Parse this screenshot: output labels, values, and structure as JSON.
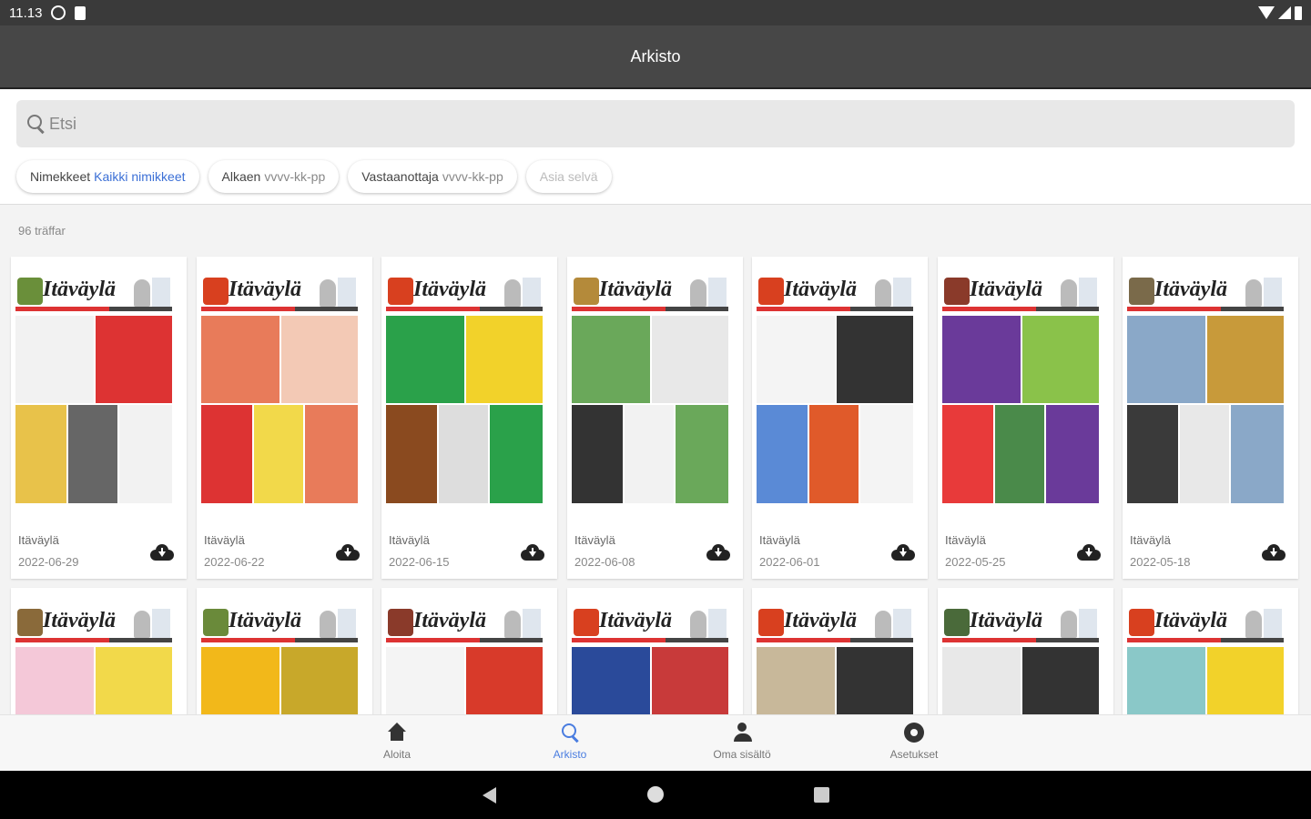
{
  "status_bar": {
    "time": "11.13"
  },
  "app_bar": {
    "title": "Arkisto"
  },
  "search": {
    "placeholder": "Etsi"
  },
  "filters": [
    {
      "label": "Nimekkeet",
      "value": "Kaikki nimikkeet"
    },
    {
      "label": "Alkaen",
      "value": "vvvv-kk-pp"
    },
    {
      "label": "Vastaanottaja",
      "value": "vvvv-kk-pp"
    },
    {
      "label": "Asia selvä",
      "value": ""
    }
  ],
  "results": {
    "count_label": "96 träffar"
  },
  "cards": [
    {
      "title": "Itäväylä",
      "date": "2022-06-29",
      "logo_color": "#6a8f3a",
      "palette": [
        "#f2f2f2",
        "#d33",
        "#e8c24a",
        "#666"
      ]
    },
    {
      "title": "Itäväylä",
      "date": "2022-06-22",
      "logo_color": "#d8401f",
      "palette": [
        "#e87b5a",
        "#f3c9b5",
        "#d33",
        "#f2d94a"
      ]
    },
    {
      "title": "Itäväylä",
      "date": "2022-06-15",
      "logo_color": "#d8401f",
      "palette": [
        "#2aa14a",
        "#f2d22a",
        "#8a4a1f",
        "#ddd"
      ]
    },
    {
      "title": "Itäväylä",
      "date": "2022-06-08",
      "logo_color": "#b48a3a",
      "palette": [
        "#6aa85a",
        "#e8e8e8",
        "#333",
        "#f2f2f2"
      ]
    },
    {
      "title": "Itäväylä",
      "date": "2022-06-01",
      "logo_color": "#d8401f",
      "palette": [
        "#f4f4f4",
        "#333",
        "#5a8ad6",
        "#e05a2a"
      ]
    },
    {
      "title": "Itäväylä",
      "date": "2022-05-25",
      "logo_color": "#8a3a2a",
      "palette": [
        "#6a3a9a",
        "#8ac24a",
        "#e83a3a",
        "#4a8a4a"
      ]
    },
    {
      "title": "Itäväylä",
      "date": "2022-05-18",
      "logo_color": "#7a6a4a",
      "palette": [
        "#8aa8c8",
        "#c89a3a",
        "#3a3a3a",
        "#e8e8e8"
      ]
    },
    {
      "title": "Itäväylä",
      "date": "",
      "logo_color": "#8a6a3a",
      "palette": [
        "#f4c8d8",
        "#f2d94a",
        "#e86a9a",
        "#ddd"
      ]
    },
    {
      "title": "Itäväylä",
      "date": "",
      "logo_color": "#6a8a3a",
      "palette": [
        "#f2b81a",
        "#c8a82a",
        "#a86a2a",
        "#ddd"
      ]
    },
    {
      "title": "Itäväylä",
      "date": "",
      "logo_color": "#8a3a2a",
      "palette": [
        "#f4f4f4",
        "#d83a2a",
        "#aaa",
        "#eee"
      ]
    },
    {
      "title": "Itäväylä",
      "date": "",
      "logo_color": "#d8401f",
      "palette": [
        "#2a4a9a",
        "#c83a3a",
        "#8aa8c8",
        "#ddd"
      ]
    },
    {
      "title": "Itäväylä",
      "date": "",
      "logo_color": "#d8401f",
      "palette": [
        "#c8b89a",
        "#333",
        "#e8e8e8",
        "#aaa"
      ]
    },
    {
      "title": "Itäväylä",
      "date": "",
      "logo_color": "#4a6a3a",
      "palette": [
        "#e8e8e8",
        "#333",
        "#d83a2a",
        "#aaa"
      ]
    },
    {
      "title": "Itäväylä",
      "date": "",
      "logo_color": "#d8401f",
      "palette": [
        "#8ac8c8",
        "#f2d22a",
        "#4a8ac8",
        "#ddd"
      ]
    }
  ],
  "bottom_nav": [
    {
      "label": "Aloita",
      "icon": "home-icon",
      "active": false
    },
    {
      "label": "Arkisto",
      "icon": "search-icon",
      "active": true
    },
    {
      "label": "Oma sisältö",
      "icon": "person-icon",
      "active": false
    },
    {
      "label": "Asetukset",
      "icon": "gear-icon",
      "active": false
    }
  ],
  "colors": {
    "app_bar": "#474747",
    "status_bar": "#3a3a3a",
    "accent": "#4a7de0",
    "chip_link": "#3b6fd6"
  }
}
